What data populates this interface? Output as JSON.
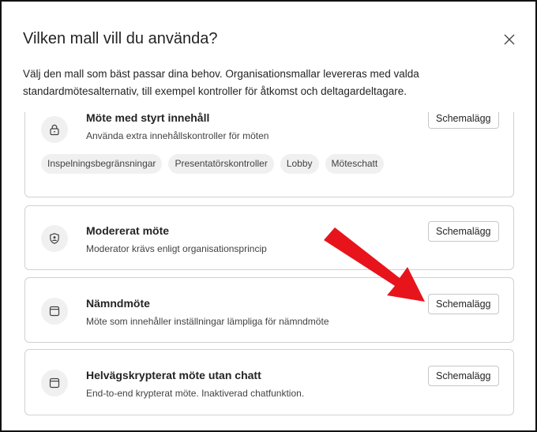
{
  "dialog": {
    "title": "Vilken mall vill du använda?",
    "description": "Välj den mall som bäst passar dina behov. Organisationsmallar levereras med valda standardmötesalternativ, till exempel kontroller för åtkomst och deltagardeltagare."
  },
  "templates": [
    {
      "title": "Möte med styrt innehåll",
      "subtitle": "Använda extra innehållskontroller för möten",
      "icon": "lock-icon",
      "button": "Schemalägg",
      "chips": [
        "Inspelningsbegränsningar",
        "Presentatörskontroller",
        "Lobby",
        "Möteschatt"
      ]
    },
    {
      "title": "Modererat möte",
      "subtitle": "Moderator krävs enligt organisationsprincip",
      "icon": "shield-person-icon",
      "button": "Schemalägg"
    },
    {
      "title": "Nämndmöte",
      "subtitle": "Möte som innehåller inställningar lämpliga för nämndmöte",
      "icon": "window-icon",
      "button": "Schemalägg"
    },
    {
      "title": "Helvägskrypterat möte utan chatt",
      "subtitle": "End-to-end krypterat möte. Inaktiverad chatfunktion.",
      "icon": "window-icon",
      "button": "Schemalägg"
    }
  ],
  "annotation": {
    "arrow_color": "#e8141b",
    "target": "Nämndmöte schedule button"
  }
}
